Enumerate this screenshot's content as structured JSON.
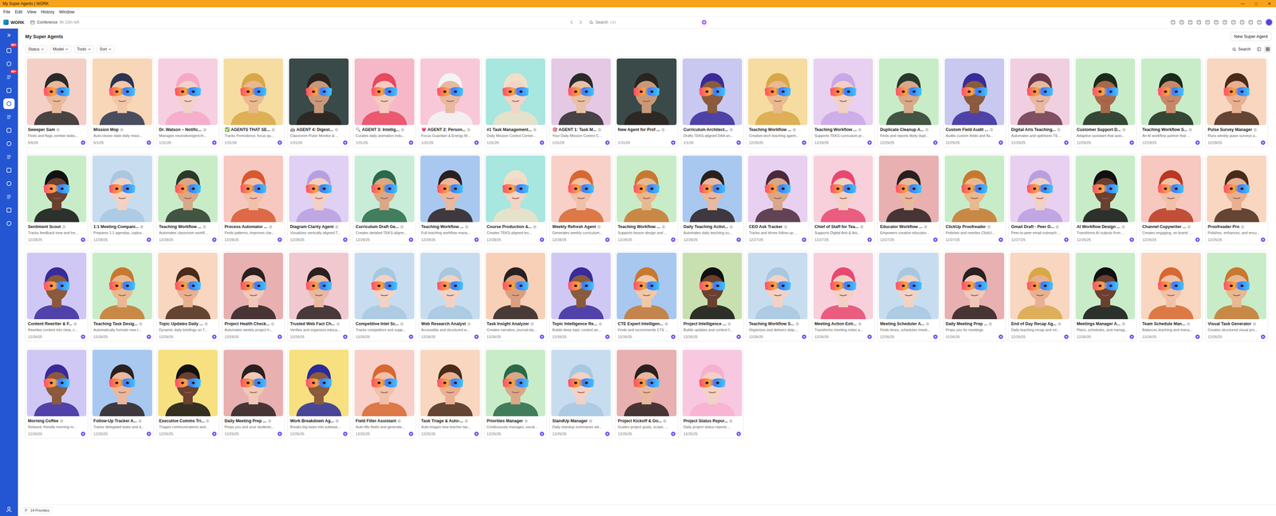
{
  "window": {
    "title": "My Super Agents | WORK",
    "controls": [
      "—",
      "□",
      "✕"
    ]
  },
  "menu": [
    "File",
    "Edit",
    "View",
    "History",
    "Window"
  ],
  "toolbar": {
    "workspace": "WORK",
    "event": "Conference",
    "event_time": "9h 23m left",
    "search": {
      "placeholder": "Search",
      "shortcut": "Ctrl"
    }
  },
  "sidebar": {
    "items": [
      {
        "badge": "99+",
        "selected": false
      },
      {
        "selected": false
      },
      {
        "badge": "99+",
        "selected": false
      },
      {
        "selected": false
      },
      {
        "selected": true
      },
      {
        "selected": false
      },
      {
        "selected": false
      },
      {
        "selected": false
      },
      {
        "selected": false
      },
      {
        "selected": false
      },
      {
        "selected": false
      },
      {
        "selected": false
      },
      {
        "selected": false
      },
      {
        "selected": false
      }
    ]
  },
  "page": {
    "title": "My Super Agents",
    "new_button": "New Super Agent",
    "filters": [
      "Status",
      "Model",
      "Tools",
      "Sort"
    ],
    "search": "Search",
    "views": [
      {
        "kind": "list",
        "selected": false
      },
      {
        "kind": "grid",
        "selected": true
      }
    ]
  },
  "agents": [
    {
      "name": "Sweeper Sam",
      "desc": "Finds and flags zombie tasks...",
      "date": "5/6/26",
      "color": "#f4cfc6",
      "skin": "#e9b99a",
      "hair": "#2a2a2a"
    },
    {
      "name": "Mission Mop",
      "desc": "Auto-closes stale daily missi...",
      "date": "5/1/26",
      "color": "#f8d6b8",
      "skin": "#f0c8a8",
      "hair": "#2c3550"
    },
    {
      "name": "Dr. Watson – Notific...",
      "desc": "Manages neurodivergent-fri...",
      "date": "1/31/26",
      "color": "#f6cfe0",
      "skin": "#f2d2c8",
      "hair": "#f5a8c8"
    },
    {
      "name": "✅ AGENTS THAT SE...",
      "desc": "Tracks Pomodoros; focus qu...",
      "date": "1/31/26",
      "color": "#f6dca0",
      "skin": "#e9b98f",
      "hair": "#d8a848"
    },
    {
      "name": "🤖 AGENT 4: Digest...",
      "desc": "Classroom Pulse Monitor & ...",
      "date": "1/31/26",
      "color": "#3a4a48",
      "skin": "#c99878",
      "hair": "#2a2320"
    },
    {
      "name": "🔍 AGENT 3: Intellig...",
      "desc": "Curates daily animation indu...",
      "date": "1/31/26",
      "color": "#f6b8c8",
      "skin": "#f3cbbf",
      "hair": "#e84860"
    },
    {
      "name": "💗 AGENT 2: Person...",
      "desc": "Focus Guardian & Energy M...",
      "date": "1/31/26",
      "color": "#f9c8d8",
      "skin": "#e8b8a0",
      "hair": "#f4f4f4"
    },
    {
      "name": "#1 Task Management...",
      "desc": "Daily Mission Control Center...",
      "date": "1/31/26",
      "color": "#a8e6e0",
      "skin": "#f3d4c6",
      "hair": "#f0e0c8"
    },
    {
      "name": "🎯 AGENT 1: Task M...",
      "desc": "Your Daily Mission Control C...",
      "date": "1/31/26",
      "color": "#e4c8e4",
      "skin": "#e8c0a4",
      "hair": "#2a2a2a"
    },
    {
      "name": "New Agent for Prof ...",
      "date": "1/31/26",
      "color": "#3a4a48",
      "skin": "#c99878",
      "hair": "#2a2320"
    },
    {
      "name": "Curriculum Architect...",
      "desc": "Drafts TEKS-aligned DAA an...",
      "date": "1/1/26",
      "color": "#c8c8f0",
      "skin": "#8a5a3c",
      "hair": "#3a2a9a"
    },
    {
      "name": "Teaching Workflow ...",
      "desc": "Creative-tech teaching agent...",
      "date": "12/29/25",
      "color": "#f6dca0",
      "skin": "#e9b98f",
      "hair": "#d8a848"
    },
    {
      "name": "Teaching Workflow ...",
      "desc": "Supports TEKS curriculum pr...",
      "date": "12/29/25",
      "color": "#e8d0f0",
      "skin": "#f2d0c4",
      "hair": "#c8a8e8"
    },
    {
      "name": "Duplicate Cleanup A...",
      "desc": "Finds and reports likely dupl...",
      "date": "12/29/25",
      "color": "#c8ecc8",
      "skin": "#d8a888",
      "hair": "#2a3a2a"
    },
    {
      "name": "Custom Field Audit ...",
      "desc": "Audits custom fields and fla...",
      "date": "12/29/25",
      "color": "#c8c8f0",
      "skin": "#8a5a3c",
      "hair": "#3a2a9a"
    },
    {
      "name": "Digital Arts Teaching...",
      "desc": "Automates and optimizes TE...",
      "date": "12/29/25",
      "color": "#f0d0e0",
      "skin": "#e8b8a0",
      "hair": "#6a3a4a"
    },
    {
      "name": "Customer Support D...",
      "desc": "Adaptive assistant that auto...",
      "date": "12/29/25",
      "color": "#c8ecc8",
      "skin": "#a86848",
      "hair": "#1a2a1a"
    },
    {
      "name": "Teaching Workflow S...",
      "desc": "An AI workflow partner that ...",
      "date": "12/29/25",
      "color": "#c8ecc8",
      "skin": "#c88868",
      "hair": "#1a2a1a"
    },
    {
      "name": "Pulse Survey Manager",
      "desc": "Runs weekly pulse surveys a...",
      "date": "12/28/25",
      "color": "#f8d6c0",
      "skin": "#e8b090",
      "hair": "#4a2a1a"
    },
    {
      "name": "Sentiment Scout",
      "desc": "Tracks feedback tone and tre...",
      "date": "12/28/25",
      "color": "#c8ecc8",
      "skin": "#6a4030",
      "hair": "#111111"
    },
    {
      "name": "1:1 Meeting Compani...",
      "desc": "Prepares 1:1 agendas, captur...",
      "date": "12/28/25",
      "color": "#c8dcf0",
      "skin": "#f2d2c4",
      "hair": "#a8c8e0"
    },
    {
      "name": "Teaching Workflow ...",
      "desc": "Automates classroom workfl...",
      "date": "12/28/25",
      "color": "#c8ecc8",
      "skin": "#d8a888",
      "hair": "#2a3a2a"
    },
    {
      "name": "Process Automator ...",
      "desc": "Finds patterns, improves clar...",
      "date": "12/28/25",
      "color": "#f6c8c0",
      "skin": "#f0c0a8",
      "hair": "#d85830"
    },
    {
      "name": "Diagram Clarity Agent",
      "desc": "Visualizes vertically aligned T...",
      "date": "12/28/25",
      "color": "#e0d0f4",
      "skin": "#f2d0c4",
      "hair": "#b8a0e0"
    },
    {
      "name": "Curriculum Draft Ge...",
      "desc": "Creates detailed TEKS-aligne...",
      "date": "12/28/25",
      "color": "#c8ecd8",
      "skin": "#d8a888",
      "hair": "#2a6a48"
    },
    {
      "name": "Teaching Workflow ...",
      "desc": "Full teaching workflow mana...",
      "date": "12/28/25",
      "color": "#a8c8f0",
      "skin": "#e8b8a0",
      "hair": "#2a2020"
    },
    {
      "name": "Course Production &...",
      "desc": "Creates TEKS-aligned les...",
      "date": "12/28/25",
      "color": "#a8e6e0",
      "skin": "#f3d4c6",
      "hair": "#f0e0c8"
    },
    {
      "name": "Weekly Refresh Agent",
      "desc": "Generates weekly curriculum...",
      "date": "12/28/25",
      "color": "#f8d0c8",
      "skin": "#f0c0a8",
      "hair": "#d86830"
    },
    {
      "name": "Teaching Workflow ...",
      "desc": "Supports lesson design and ...",
      "date": "12/28/25",
      "color": "#c8ecc8",
      "skin": "#e8b890",
      "hair": "#c87830"
    },
    {
      "name": "Daily Teaching Activi...",
      "desc": "Automates daily teaching su...",
      "date": "12/28/25",
      "color": "#a8c8f0",
      "skin": "#e8b8a0",
      "hair": "#2a2020"
    },
    {
      "name": "CEO Ask Tracker",
      "desc": "Tracks and drives follow-up ...",
      "date": "12/27/25",
      "color": "#e8d0f0",
      "skin": "#d8a888",
      "hair": "#4a2a3a"
    },
    {
      "name": "Chief of Staff for Tea...",
      "desc": "Supports Digital Arts & Ani...",
      "date": "12/27/25",
      "color": "#f8d0dc",
      "skin": "#f2d0c4",
      "hair": "#e84870"
    },
    {
      "name": "Educator Workflow ...",
      "desc": "Empowers creative educator...",
      "date": "12/27/25",
      "color": "#e8b0b0",
      "skin": "#e8b8a0",
      "hair": "#2a2020"
    },
    {
      "name": "ClickUp Proofreader",
      "desc": "Polishes and rewrites ClickU...",
      "date": "12/27/25",
      "color": "#c8ecc8",
      "skin": "#e8b890",
      "hair": "#c87830"
    },
    {
      "name": "Gmail Draft - Peer O...",
      "desc": "Peer-to-peer email outreach ...",
      "date": "12/27/25",
      "color": "#e8d0f0",
      "skin": "#f2d0c4",
      "hair": "#b8a0e0"
    },
    {
      "name": "AI Workflow Design ...",
      "desc": "Transforms AI outputs from ...",
      "date": "12/26/25",
      "color": "#c8ecc8",
      "skin": "#6a4030",
      "hair": "#111111"
    },
    {
      "name": "Channel Copywriter ...",
      "desc": "Creates engaging, on-brand ...",
      "date": "12/26/25",
      "color": "#f6c8c0",
      "skin": "#f0c0a8",
      "hair": "#b83820"
    },
    {
      "name": "Proofreader Pro",
      "desc": "Polishes, enhances, and ensu...",
      "date": "12/26/25",
      "color": "#f8d6c0",
      "skin": "#e8b090",
      "hair": "#4a2a1a"
    },
    {
      "name": "Content Rewriter & F...",
      "desc": "Rewrites content into clear, c...",
      "date": "12/26/25",
      "color": "#d0c8f4",
      "skin": "#8a5a3c",
      "hair": "#3a2a9a"
    },
    {
      "name": "Teaching Task Desig...",
      "desc": "Automatically formats new t...",
      "date": "12/26/25",
      "color": "#c8ecc8",
      "skin": "#e8b890",
      "hair": "#c87830"
    },
    {
      "name": "Topic Updates Daily ...",
      "desc": "Dynamic daily briefings on T...",
      "date": "12/26/25",
      "color": "#f8d6c0",
      "skin": "#e8b090",
      "hair": "#4a2a1a"
    },
    {
      "name": "Project Health Check...",
      "desc": "Automates weekly project h...",
      "date": "12/26/25",
      "color": "#e8b0b0",
      "skin": "#f0c8b8",
      "hair": "#2a2020"
    },
    {
      "name": "Trusted Web Fact Ch...",
      "desc": "Verifies and organizes educa...",
      "date": "12/26/25",
      "color": "#f0c8d0",
      "skin": "#e8b8a0",
      "hair": "#2a2020"
    },
    {
      "name": "Competitive Intel Sc...",
      "desc": "Tracks competitors and supp...",
      "date": "12/26/25",
      "color": "#c8dcf0",
      "skin": "#f2d2c4",
      "hair": "#a8c8e0"
    },
    {
      "name": "Web Research Analyst",
      "desc": "Accessible and structured w...",
      "date": "12/26/25",
      "color": "#c8dcf0",
      "skin": "#f2d2c4",
      "hair": "#a8c8e0"
    },
    {
      "name": "Task Insight Analyzer",
      "desc": "Creates narrative, journal-sty...",
      "date": "12/26/25",
      "color": "#f8d0b8",
      "skin": "#d8a080",
      "hair": "#2a2020"
    },
    {
      "name": "Topic Intelligence Re...",
      "desc": "Builds deep topic context an...",
      "date": "12/26/25",
      "color": "#d0c8f4",
      "skin": "#8a5a3c",
      "hair": "#3a2a9a"
    },
    {
      "name": "CTE Expert Intelligen...",
      "desc": "Finds and recommends CTE ...",
      "date": "12/26/25",
      "color": "#a8c8f0",
      "skin": "#f0c8a8",
      "hair": "#c87830"
    },
    {
      "name": "Project Intelligence ...",
      "desc": "Builds updates and context f...",
      "date": "12/26/25",
      "color": "#c8e0b0",
      "skin": "#6a4030",
      "hair": "#111111"
    },
    {
      "name": "Teaching Workflow S...",
      "desc": "Organizes and delivers step-...",
      "date": "12/26/25",
      "color": "#c8dcf0",
      "skin": "#f2d2c4",
      "hair": "#a8c8e0"
    },
    {
      "name": "Meeting Action Extr...",
      "desc": "Transforms meeting notes a...",
      "date": "12/26/25",
      "color": "#f8d0dc",
      "skin": "#f2d0c4",
      "hair": "#e84870"
    },
    {
      "name": "Meeting Scheduler A...",
      "desc": "Finds times, schedules meeti...",
      "date": "12/26/25",
      "color": "#c8dcf0",
      "skin": "#f2d2c4",
      "hair": "#a8c8e0"
    },
    {
      "name": "Daily Meeting Prep ...",
      "desc": "Preps you for meetings",
      "date": "12/26/25",
      "color": "#e8b0b0",
      "skin": "#f0c8b8",
      "hair": "#2a2020"
    },
    {
      "name": "End of Day Recap Ag...",
      "desc": "Daily teaching recap and rel...",
      "date": "12/26/25",
      "color": "#f8d6c0",
      "skin": "#e8b090",
      "hair": "#d8a848"
    },
    {
      "name": "Meetings Manager A...",
      "desc": "Plans, schedules, and manag...",
      "date": "12/26/25",
      "color": "#c8ecc8",
      "skin": "#6a4030",
      "hair": "#111111"
    },
    {
      "name": "Team Schedule Man...",
      "desc": "Balances teaching and mana...",
      "date": "12/26/25",
      "color": "#f8d6c0",
      "skin": "#f0c0a8",
      "hair": "#d86830"
    },
    {
      "name": "Visual Task Generator",
      "desc": "Creates structured visual pro...",
      "date": "12/26/25",
      "color": "#c8ecc8",
      "skin": "#e8b890",
      "hair": "#c87830"
    },
    {
      "name": "Morning Coffee",
      "desc": "Relaxed, friendly morning m...",
      "date": "12/26/25",
      "color": "#d0c8f4",
      "skin": "#8a5a3c",
      "hair": "#3a2a9a"
    },
    {
      "name": "Follow-Up Tracker A...",
      "desc": "Tracks delegated tasks and d...",
      "date": "12/25/25",
      "color": "#a8c8f0",
      "skin": "#e8b8a0",
      "hair": "#2a2020"
    },
    {
      "name": "Executive Comms Tri...",
      "desc": "Triages communications and...",
      "date": "12/25/25",
      "color": "#f6e080",
      "skin": "#6a4030",
      "hair": "#111111"
    },
    {
      "name": "Daily Meeting Prep ...",
      "desc": "Preps you and your students...",
      "date": "12/25/25",
      "color": "#e8b0b0",
      "skin": "#f0c8b8",
      "hair": "#2a2020"
    },
    {
      "name": "Work Breakdown Ag...",
      "desc": "Breaks big tasks into subtask...",
      "date": "12/25/25",
      "color": "#f6e080",
      "skin": "#8a5a3c",
      "hair": "#2a2a9a"
    },
    {
      "name": "Field Filler Assistant",
      "desc": "Auto-fills fields and generate...",
      "date": "12/25/25",
      "color": "#f8d0c8",
      "skin": "#f0c0a8",
      "hair": "#d86830"
    },
    {
      "name": "Task Triage & Auto-...",
      "desc": "Auto-triages new teacher tas...",
      "date": "12/25/25",
      "color": "#f8d6c0",
      "skin": "#e8b090",
      "hair": "#4a2a1a"
    },
    {
      "name": "Priorities Manager",
      "desc": "Continuously manages, escal...",
      "date": "12/25/25",
      "color": "#c8ecc8",
      "skin": "#d8a888",
      "hair": "#2a6a48"
    },
    {
      "name": "StandUp Manager",
      "desc": "Daily standup summaries wit...",
      "date": "12/25/25",
      "color": "#c8dcf0",
      "skin": "#f2d2c4",
      "hair": "#a8c8e0"
    },
    {
      "name": "Project Kickoff & Go...",
      "desc": "Guides project goals, scope, ...",
      "date": "12/25/25",
      "color": "#e8b0b0",
      "skin": "#e8b8a0",
      "hair": "#2a2020"
    },
    {
      "name": "Project Status Repor...",
      "desc": "Daily project status reports ...",
      "date": "12/25/25",
      "color": "#f8c8e0",
      "skin": "#f2d2c4",
      "hair": "#f8b0d0"
    }
  ],
  "status_bar": {
    "label": "14 Priorities"
  }
}
